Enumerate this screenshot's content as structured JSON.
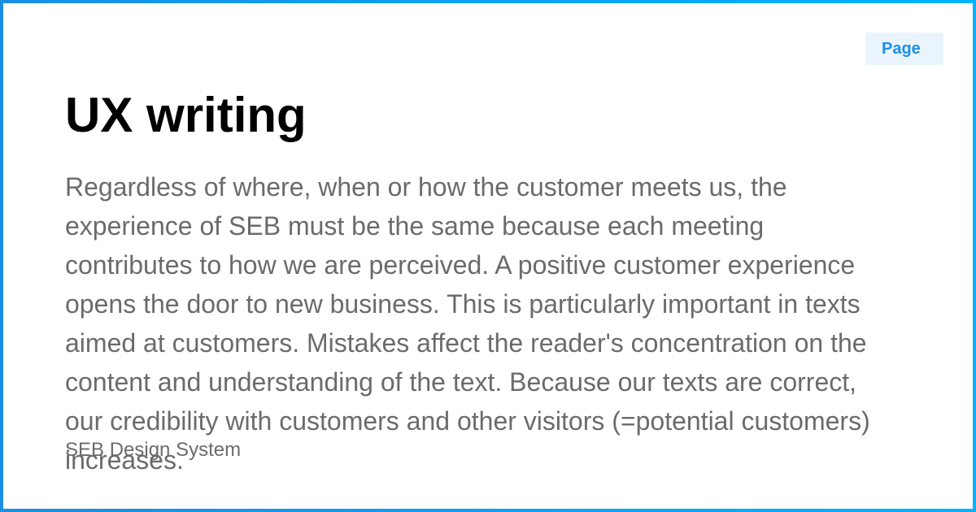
{
  "badge": {
    "label": "Page"
  },
  "page": {
    "title": "UX writing",
    "description": "Regardless of where, when or how the customer meets us, the experience of SEB must be the same because each meeting contributes to how we are perceived. A positive customer experience opens the door to new business. This is particularly important in texts aimed at customers. Mistakes affect the reader's concentration on the content and understanding of the text. Because our texts are correct, our credibility with customers and other visitors (=potential customers) increases."
  },
  "footer": {
    "site_name": "SEB Design System"
  },
  "colors": {
    "border_gradient_start": "#1a8fe3",
    "border_gradient_end": "#00b2ff",
    "badge_background": "#eaf4fd",
    "badge_text": "#1a8fe3",
    "title_text": "#000000",
    "body_text": "#6b6b6b"
  }
}
